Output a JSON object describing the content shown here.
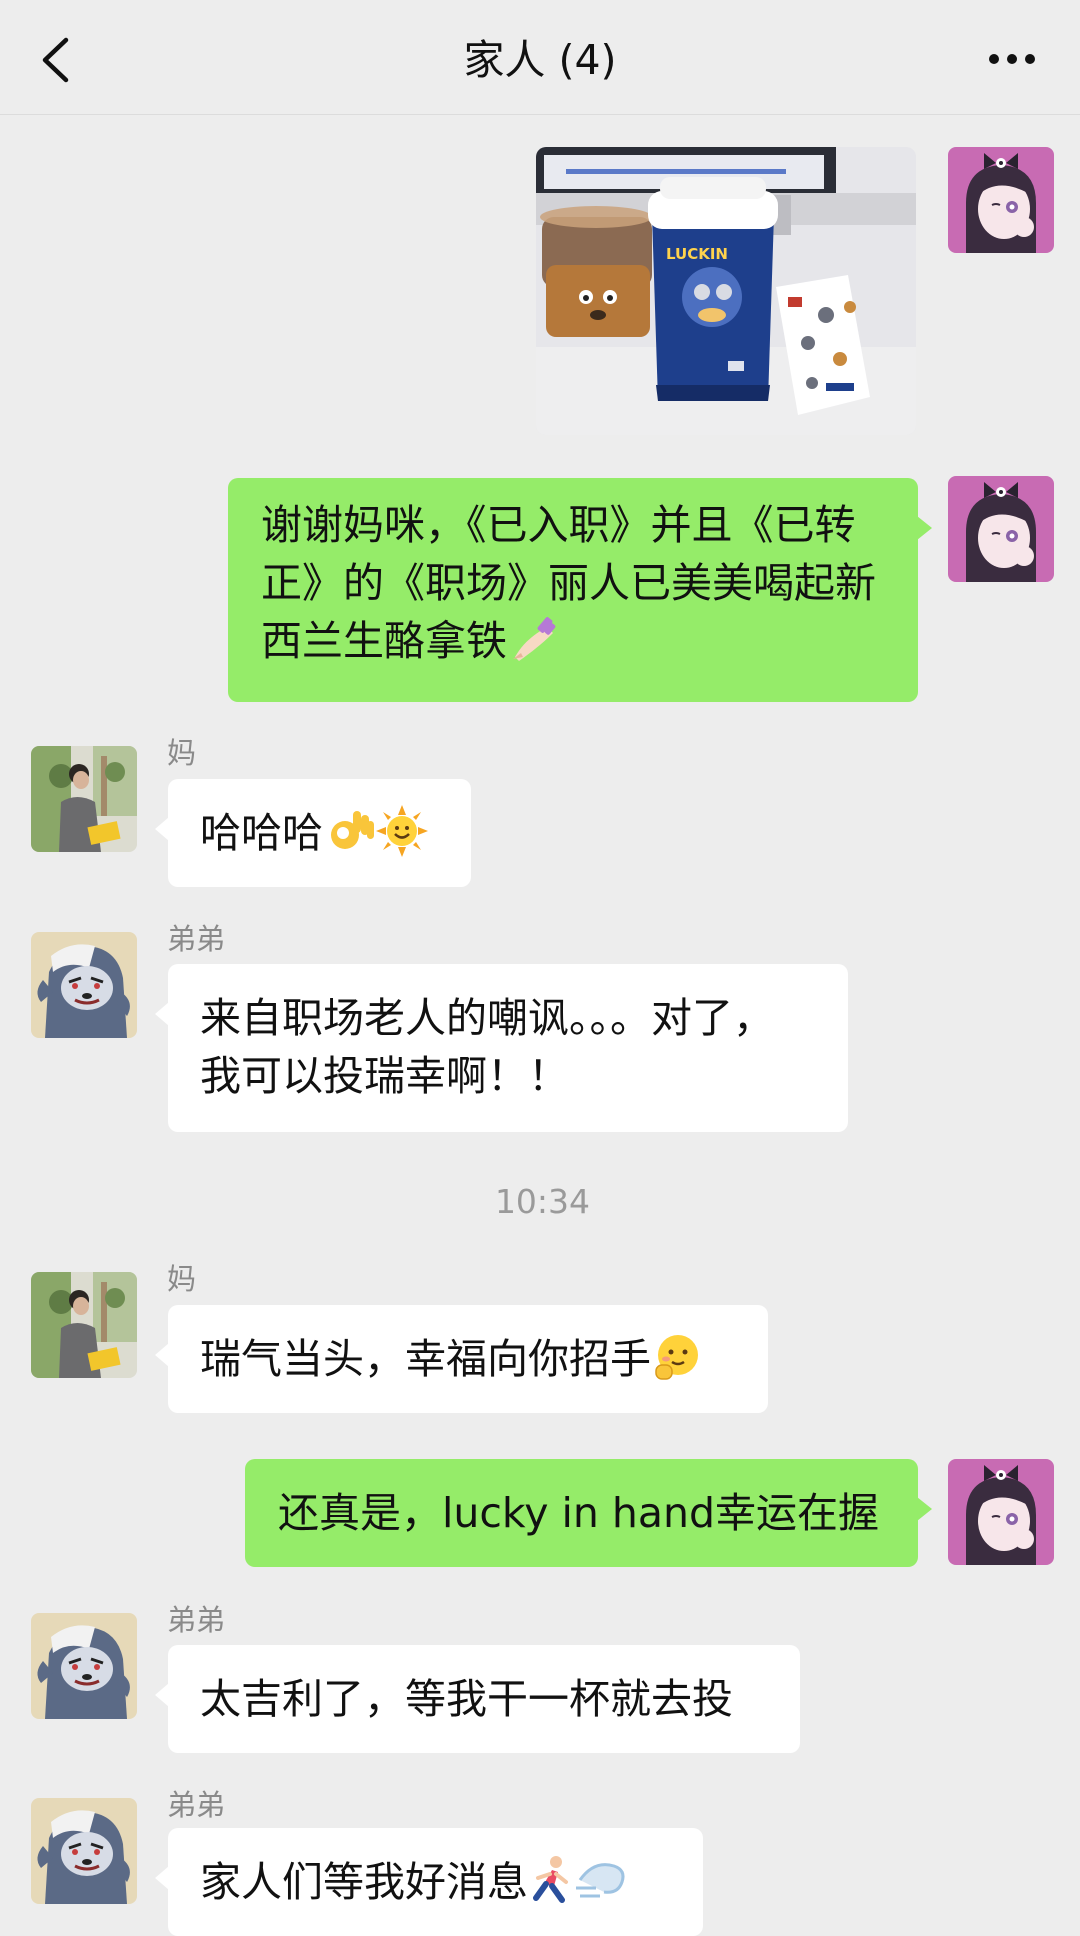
{
  "header": {
    "title": "家人 (4)"
  },
  "icons": {
    "back": "chevron-left-icon",
    "more": "more-dots-icon"
  },
  "colors": {
    "background": "#ededed",
    "self_bubble": "#95ec69",
    "other_bubble": "#ffffff"
  },
  "messages": [
    {
      "sender": "self",
      "type": "image"
    },
    {
      "sender": "self",
      "type": "text",
      "lines": [
        "谢谢妈咪，《已入职》并且《已转",
        "正》的《职场》丽人已美美喝起新",
        "西兰生酪拿铁"
      ],
      "emoji": "nail-polish"
    },
    {
      "sender": "妈",
      "type": "text",
      "text": "哈哈哈",
      "emoji": [
        "ok-hand",
        "sun-face"
      ]
    },
    {
      "sender": "弟弟",
      "type": "text",
      "lines": [
        "来自职场老人的嘲讽。。。对了，",
        "我可以投瑞幸啊！！"
      ]
    },
    {
      "type": "time",
      "text": "10:34"
    },
    {
      "sender": "妈",
      "type": "text",
      "text": "瑞气当头，幸福向你招手",
      "emoji": [
        "shy-face"
      ]
    },
    {
      "sender": "self",
      "type": "text",
      "text": "还真是，lucky in hand幸运在握"
    },
    {
      "sender": "弟弟",
      "type": "text",
      "text": "太吉利了，等我干一杯就去投"
    },
    {
      "sender": "弟弟",
      "type": "text",
      "text": "家人们等我好消息",
      "emoji": [
        "running-person",
        "dash"
      ]
    }
  ]
}
